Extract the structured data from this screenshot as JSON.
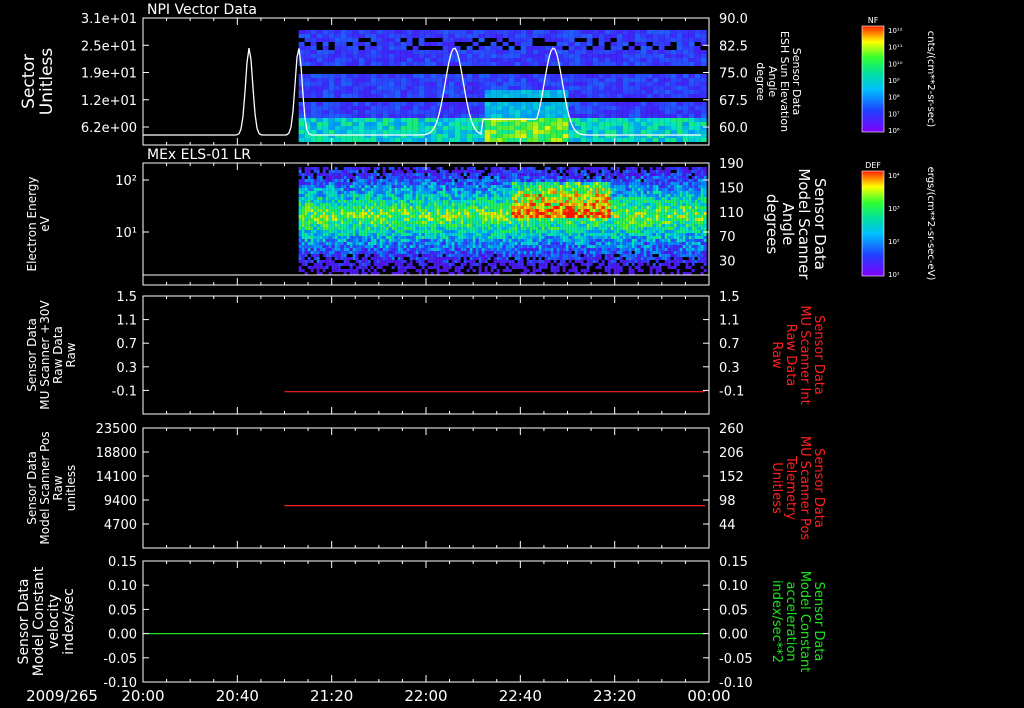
{
  "x_axis": {
    "date_label": "2009/265",
    "ticks": [
      "20:00",
      "20:40",
      "21:20",
      "22:00",
      "22:40",
      "23:20",
      "00:00"
    ]
  },
  "chart_data": [
    {
      "type": "heatmap",
      "title": "NPI Vector Data",
      "ylabel": [
        "Sector",
        "Unitless"
      ],
      "yticks": [
        "3.1e+01",
        "2.5e+01",
        "1.9e+01",
        "1.2e+01",
        "6.2e+00"
      ],
      "y2label": [
        "Sensor Data",
        "ESH Sun Elevation",
        "Angle",
        "degree"
      ],
      "y2ticks": [
        "90.0",
        "82.5",
        "75.0",
        "67.5",
        "60.0"
      ],
      "colorbar": {
        "label": "NF",
        "units": "cnts/(cm**2-sr-sec)",
        "ticks": [
          "10¹²",
          "10¹¹",
          "10¹⁰",
          "10⁹",
          "10⁸",
          "10⁷",
          "10⁶"
        ]
      },
      "overlay_line": {
        "color": "#ffffff",
        "peaks_hours": [
          20.75,
          21.1,
          22.2,
          22.9
        ]
      }
    },
    {
      "type": "heatmap",
      "title": "MEx ELS-01 LR",
      "ylabel": [
        "Electron Energy",
        "eV"
      ],
      "yticks": [
        "10²",
        "10¹"
      ],
      "y2label": [
        "Sensor Data",
        "Model Scanner",
        "Angle",
        "degrees"
      ],
      "y2ticks": [
        "190",
        "150",
        "110",
        "70",
        "30"
      ],
      "colorbar": {
        "label": "DEF",
        "units": "ergs/(cm**2-sr-sec-eV)",
        "ticks": [
          "10⁴",
          "10³",
          "10²",
          "10¹"
        ]
      }
    },
    {
      "type": "line",
      "ylabel": [
        "Sensor Data",
        "MU Scanner +30V",
        "Raw Data",
        "Raw"
      ],
      "yticks": [
        "1.5",
        "1.1",
        "0.7",
        "0.3",
        "-0.1"
      ],
      "ylim": [
        -0.35,
        1.5
      ],
      "y2label": [
        "Sensor Data",
        "MU Scanner Int",
        "Raw Data",
        "Raw"
      ],
      "y2ticks": [
        "1.5",
        "1.1",
        "0.7",
        "0.3",
        "-0.1"
      ],
      "series": [
        {
          "color": "#ff2020",
          "x_start": "21:00",
          "x_end": "00:00",
          "value": 0.0
        }
      ]
    },
    {
      "type": "line",
      "ylabel": [
        "Sensor Data",
        "Model Scanner Pos",
        "Raw",
        "unitless"
      ],
      "yticks": [
        "23500",
        "18800",
        "14100",
        "9400",
        "4700"
      ],
      "ylim": [
        0,
        23500
      ],
      "y2label": [
        "Sensor Data",
        "MU Scanner Pos",
        "Telemetry",
        "Unitless"
      ],
      "y2ticks": [
        "260",
        "206",
        "152",
        "98",
        "44"
      ],
      "series": [
        {
          "color": "#ff2020",
          "x_start": "21:00",
          "x_end": "00:00",
          "value": 8300
        }
      ]
    },
    {
      "type": "line",
      "ylabel": [
        "Sensor Data",
        "Model Constant",
        "velocity",
        "index/sec"
      ],
      "yticks": [
        "0.15",
        "0.10",
        "0.05",
        "0.00",
        "-0.05",
        "-0.10"
      ],
      "ylim": [
        -0.1,
        0.15
      ],
      "y2label": [
        "Sensor Data",
        "Model Constant",
        "acceleration",
        "index/sec**2"
      ],
      "y2ticks": [
        "0.15",
        "0.10",
        "0.05",
        "0.00",
        "-0.05",
        "-0.10"
      ],
      "series": [
        {
          "color": "#20e020",
          "x_start": "20:00",
          "x_end": "00:00",
          "value": 0.0
        }
      ]
    }
  ],
  "colors": {
    "axis": "#ffffff",
    "red_label": "#ff2020",
    "green_label": "#20e020"
  }
}
